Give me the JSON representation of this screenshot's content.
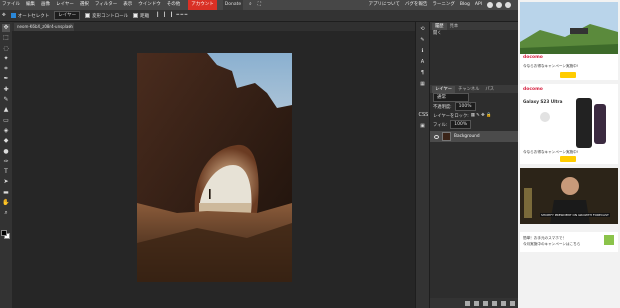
{
  "menubar": {
    "items": [
      "ファイル",
      "編集",
      "画像",
      "レイヤー",
      "選択",
      "フィルター",
      "表示",
      "ウインドウ",
      "その他"
    ],
    "account_label": "アカウント",
    "donate_label": "Donate",
    "right_items": [
      "アプリについて",
      "バグを報告",
      "ラーニング",
      "Blog",
      "API"
    ]
  },
  "options": {
    "autoselect_label": "オートセレクト",
    "layer_select": "レイヤー",
    "transform_label": "変形コントロール",
    "distance_label": "距離"
  },
  "document": {
    "tab_label": "neom-K6bX_z08r4-unsplash",
    "close_glyph": "×"
  },
  "history_panel": {
    "tabs": [
      "履歴",
      "見本"
    ],
    "items": [
      "開く"
    ]
  },
  "strip": {
    "label": "CSS"
  },
  "layers_panel": {
    "tabs": [
      "レイヤー",
      "チャンネル",
      "パス"
    ],
    "blend_mode": "通常",
    "opacity_label": "不透明度:",
    "opacity_value": "100%",
    "lock_label": "レイヤーをロック:",
    "fill_label": "フィル:",
    "fill_value": "100%",
    "layers": [
      {
        "name": "Background"
      }
    ]
  },
  "ads": {
    "ad1": {
      "brand": "docomo",
      "text": "今ならお得なキャンペーン実施中!"
    },
    "ad2": {
      "brand": "docomo",
      "title": "Galaxy S23 Ultra",
      "text": "今ならお得なキャンペーン実施中!"
    },
    "ad3": {
      "caption": "SHOPIFY PRESIDENT ON GROWTH FORECAST"
    },
    "ad4": {
      "line1": "簡単！お手元のスマホで！",
      "line2": "今月実施中のキャンペーンはこちら"
    }
  },
  "colors": {
    "accent": "#2a87d8",
    "account": "#d93025",
    "docomo": "#d6203f"
  }
}
